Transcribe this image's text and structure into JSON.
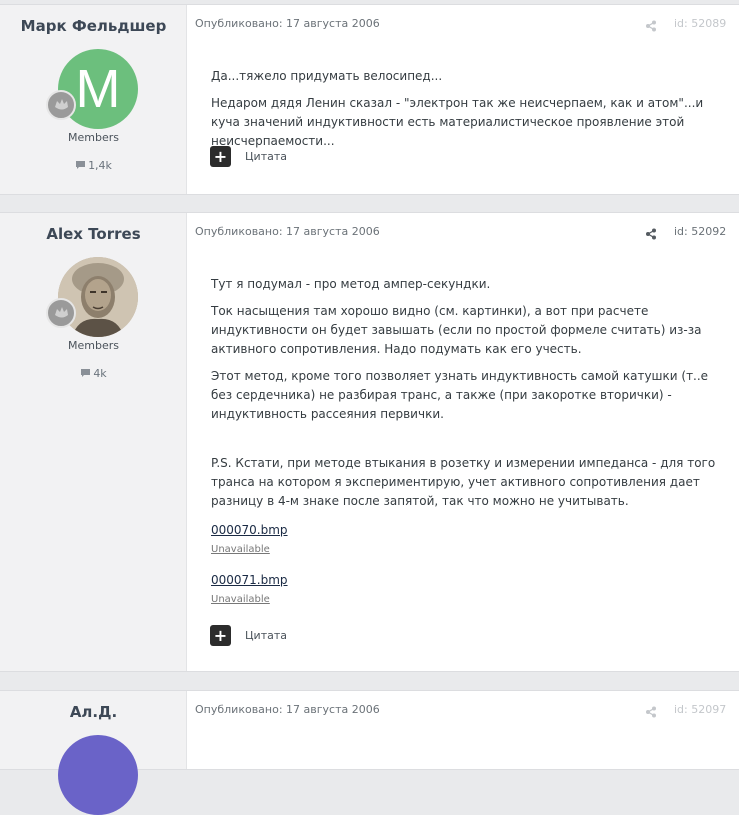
{
  "posts": [
    {
      "author": "Марк Фельдшер",
      "avatar_letter": "M",
      "avatar_color": "#6cbf7d",
      "group": "Members",
      "content_count": "1,4k",
      "published": "Опубликовано: 17 августа 2006",
      "id": "id: 52089",
      "paragraphs": [
        "Да...тяжело придумать велосипед...",
        "Недаром дядя Ленин сказал - \"электрон так же неисчерпаем, как и атом\"...и куча значений индуктивности есть материалистическое проявление этой неисчерпаемости..."
      ],
      "quote_label": "Цитата"
    },
    {
      "author": "Alex Torres",
      "group": "Members",
      "content_count": "4k",
      "published": "Опубликовано: 17 августа 2006",
      "id": "id: 52092",
      "paragraphs": [
        "Тут я подумал - про метод ампер-секундки.",
        "Ток насыщения там хорошо видно (см. картинки), а вот при расчете индуктивности он будет завышать (если по простой формеле считать) из-за активного сопротивления. Надо подумать как его учесть.",
        "Этот метод, кроме того позволяет узнать индуктивность самой катушки (т..е без сердечника) не разбирая транс, а также (при закоротке вторички) - индуктивность рассеяния первички.",
        "P.S. Кстати, при методе втыкания в розетку и измерении импеданса - для того транса на котором я экспериментирую, учет активного сопротивления дает разницу в 4-м знаке после запятой, так что можно не учитывать."
      ],
      "attachments": [
        {
          "name": "000070.bmp",
          "status": "Unavailable"
        },
        {
          "name": "000071.bmp",
          "status": "Unavailable"
        }
      ],
      "quote_label": "Цитата"
    },
    {
      "author": "Ал.Д.",
      "avatar_color": "#6a63c8",
      "published": "Опубликовано: 17 августа 2006",
      "id": "id: 52097"
    }
  ]
}
